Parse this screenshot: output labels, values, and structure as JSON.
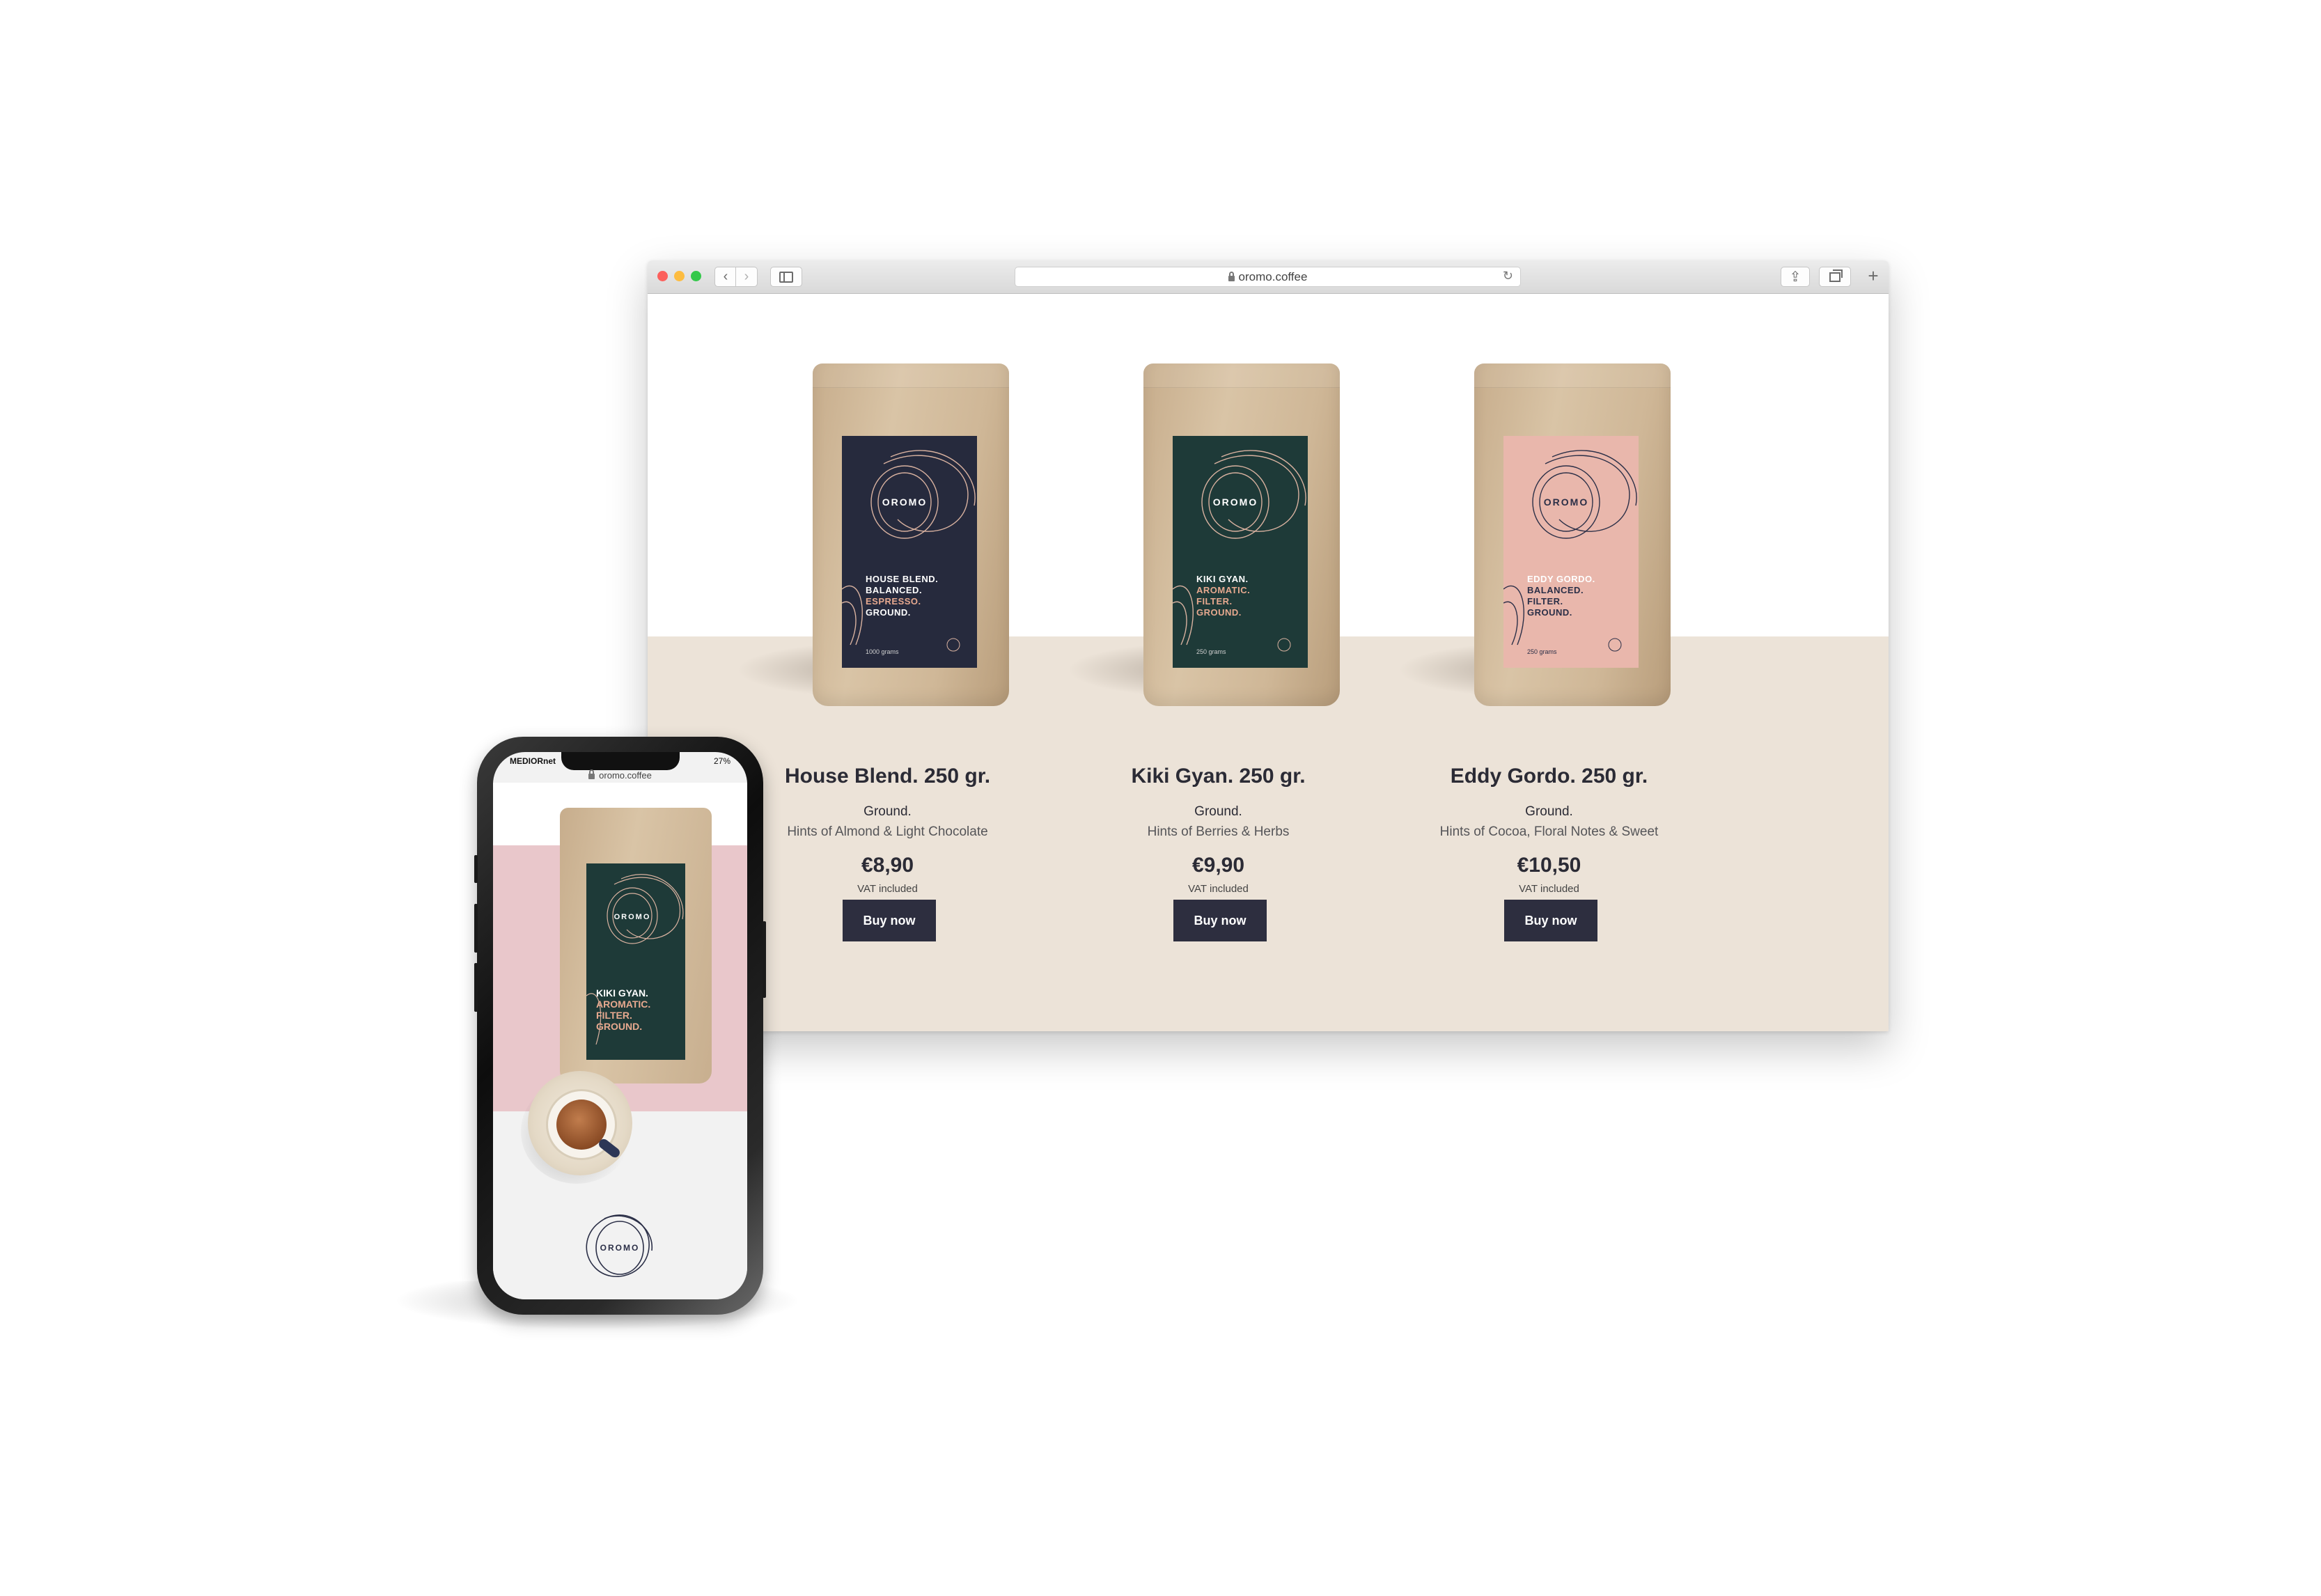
{
  "browser": {
    "url": "oromo.coffee",
    "back_icon": "chevron-left-icon",
    "forward_icon": "chevron-right-icon",
    "reload_icon": "reload-icon",
    "share_icon": "share-icon",
    "plus_label": "+"
  },
  "brand": {
    "logo_text": "OROMO",
    "colors": {
      "button": "#2d2e3f",
      "floor": "#ece3d8",
      "label_navy": "#262a3d",
      "label_green": "#1e3a38",
      "label_pink": "#e9b7ac",
      "accent": "#e7a98f"
    }
  },
  "products": [
    {
      "name": "House Blend. 250 gr.",
      "grind": "Ground.",
      "notes": "Hints of Almond & Light Chocolate",
      "price": "€8,90",
      "vat": "VAT included",
      "button": "Buy now",
      "label_line1": "HOUSE BLEND.",
      "label_line2": "BALANCED.",
      "label_line3": "ESPRESSO.",
      "label_line4": "GROUND.",
      "weight": "1000 grams"
    },
    {
      "name": "Kiki Gyan. 250 gr.",
      "grind": "Ground.",
      "notes": "Hints of Berries & Herbs",
      "price": "€9,90",
      "vat": "VAT included",
      "button": "Buy now",
      "label_line1": "KIKI GYAN.",
      "label_line2": "AROMATIC.",
      "label_line3": "FILTER.",
      "label_line4": "GROUND.",
      "weight": "250 grams"
    },
    {
      "name": "Eddy Gordo. 250 gr.",
      "grind": "Ground.",
      "notes": "Hints of Cocoa, Floral Notes & Sweet",
      "price": "€10,50",
      "vat": "VAT included",
      "button": "Buy now",
      "label_line1": "EDDY GORDO.",
      "label_line2": "BALANCED.",
      "label_line3": "FILTER.",
      "label_line4": "GROUND.",
      "weight": "250 grams"
    }
  ],
  "phone": {
    "carrier": "MEDIORnet",
    "battery": "27%",
    "url": "oromo.coffee",
    "label_line1": "KIKI GYAN.",
    "label_line2": "AROMATIC.",
    "label_line3": "FILTER.",
    "label_line4": "GROUND."
  }
}
